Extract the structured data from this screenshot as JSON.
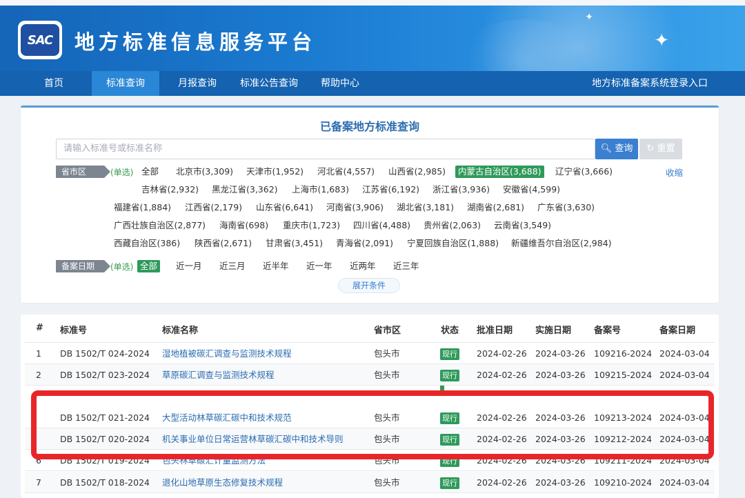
{
  "header": {
    "logo_text": "SAC",
    "title": "地方标准信息服务平台"
  },
  "nav": {
    "items": [
      "首页",
      "标准查询",
      "月报查询",
      "标准公告查询",
      "帮助中心"
    ],
    "active": "标准查询",
    "login": "地方标准备案系统登录入口"
  },
  "search": {
    "title": "已备案地方标准查询",
    "placeholder": "请输入标准号或标准名称",
    "query_label": "查询",
    "reset_label": "重置",
    "province_label": "省市区",
    "single_select": "(单选)",
    "collapse": "收缩",
    "provinces": [
      [
        "全部",
        "北京市(3,309)",
        "天津市(1,952)",
        "河北省(4,557)",
        "山西省(2,985)",
        "内蒙古自治区(3,688)",
        "辽宁省(3,666)"
      ],
      [
        "吉林省(2,932)",
        "黑龙江省(3,362)",
        "上海市(1,683)",
        "江苏省(6,192)",
        "浙江省(3,936)",
        "安徽省(4,599)"
      ],
      [
        "福建省(1,884)",
        "江西省(2,179)",
        "山东省(6,641)",
        "河南省(3,906)",
        "湖北省(3,181)",
        "湖南省(2,681)",
        "广东省(3,630)"
      ],
      [
        "广西壮族自治区(2,877)",
        "海南省(698)",
        "重庆市(1,723)",
        "四川省(4,488)",
        "贵州省(2,063)",
        "云南省(3,549)"
      ],
      [
        "西藏自治区(386)",
        "陕西省(2,671)",
        "甘肃省(3,451)",
        "青海省(2,091)",
        "宁夏回族自治区(1,888)",
        "新疆维吾尔自治区(2,984)"
      ]
    ],
    "selected_province": "内蒙古自治区(3,688)",
    "date_label": "备案日期",
    "dates": [
      "全部",
      "近一月",
      "近三月",
      "近半年",
      "近一年",
      "近两年",
      "近三年"
    ],
    "selected_date": "全部",
    "expand": "展开条件"
  },
  "table": {
    "headers": [
      "#",
      "标准号",
      "标准名称",
      "省市区",
      "状态",
      "批准日期",
      "实施日期",
      "备案号",
      "备案日期"
    ],
    "rows": [
      {
        "idx": "1",
        "code": "DB 1502/T 024-2024",
        "name": "湿地植被碳汇调查与监测技术规程",
        "region": "包头市",
        "status": "现行",
        "approve": "2024-02-26",
        "implement": "2024-03-26",
        "record": "109216-2024",
        "record_date": "2024-03-04"
      },
      {
        "idx": "2",
        "code": "DB 1502/T 023-2024",
        "name": "草原碳汇调查与监测技术规程",
        "region": "包头市",
        "status": "现行",
        "approve": "2024-02-26",
        "implement": "2024-03-26",
        "record": "109215-2024",
        "record_date": "2024-03-04"
      },
      {
        "idx": "",
        "code": "DB 1502/T 021-2024",
        "name": "大型活动林草碳汇碳中和技术规范",
        "region": "包头市",
        "status": "现行",
        "approve": "2024-02-26",
        "implement": "2024-03-26",
        "record": "109213-2024",
        "record_date": "2024-03-04"
      },
      {
        "idx": "",
        "code": "DB 1502/T 020-2024",
        "name": "机关事业单位日常运营林草碳汇碳中和技术导则",
        "region": "包头市",
        "status": "现行",
        "approve": "2024-02-26",
        "implement": "2024-03-26",
        "record": "109212-2024",
        "record_date": "2024-03-04"
      },
      {
        "idx": "6",
        "code": "DB 1502/T 019-2024",
        "name": "包头林草碳汇计量监测方法",
        "region": "包头市",
        "status": "现行",
        "approve": "2024-02-26",
        "implement": "2024-03-26",
        "record": "109211-2024",
        "record_date": "2024-03-04"
      },
      {
        "idx": "7",
        "code": "DB 1502/T 018-2024",
        "name": "退化山地草原生态修复技术规程",
        "region": "包头市",
        "status": "现行",
        "approve": "2024-02-26",
        "implement": "2024-03-26",
        "record": "109210-2024",
        "record_date": "2024-03-04"
      }
    ]
  }
}
